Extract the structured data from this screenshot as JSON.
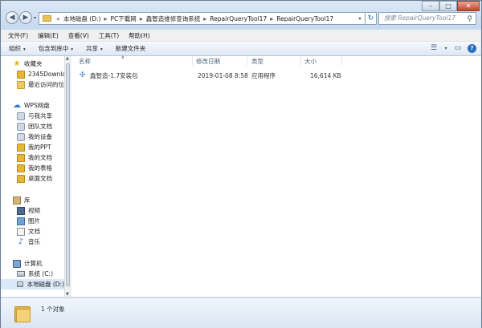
{
  "window": {
    "minimize": "–",
    "maximize": "□",
    "close": "✕"
  },
  "nav": {
    "back": "◀",
    "forward": "▶",
    "history": "▾"
  },
  "address": {
    "leading": "«",
    "crumbs": [
      "本地磁盘 (D:)",
      "PC下载网",
      "鑫智造维修查询系统",
      "RepairQueryTool17",
      "RepairQueryTool17"
    ],
    "separator": "▸",
    "dropdown": "▾",
    "refresh": "↻"
  },
  "search": {
    "placeholder": "搜索 RepairQueryTool17",
    "icon": "search-icon"
  },
  "menubar": [
    "文件(F)",
    "编辑(E)",
    "查看(V)",
    "工具(T)",
    "帮助(H)"
  ],
  "toolbar": {
    "organize": "组织",
    "include": "包含到库中",
    "share": "共享",
    "new_folder": "新建文件夹",
    "caret": "▾",
    "view_icon": "☰",
    "preview_icon": "▭",
    "help_icon": "?"
  },
  "sidebar": {
    "favorites": {
      "label": "收藏夹",
      "items": [
        "2345Downloa",
        "最近访问的位置"
      ]
    },
    "wps": {
      "label": "WPS网盘",
      "items": [
        "与我共享",
        "团队文档",
        "我的设备",
        "我的PPT",
        "我的文档",
        "我的表格",
        "桌面文档"
      ]
    },
    "library": {
      "label": "库",
      "items": [
        "视频",
        "图片",
        "文档",
        "音乐"
      ]
    },
    "computer": {
      "label": "计算机",
      "items": [
        "系统 (C:)",
        "本地磁盘 (D:)"
      ]
    }
  },
  "columns": {
    "name": "名称",
    "modified": "修改日期",
    "type": "类型",
    "size": "大小"
  },
  "files": [
    {
      "name": "鑫智造-1.7安装包",
      "modified": "2019-01-08 8:58",
      "type": "应用程序",
      "size": "16,614 KB"
    }
  ],
  "status": {
    "count": "1 个对象"
  },
  "colors": {
    "accent": "#2b6cc4",
    "selection": "#dbe8f7",
    "window_frame": "#d7e4f2"
  }
}
